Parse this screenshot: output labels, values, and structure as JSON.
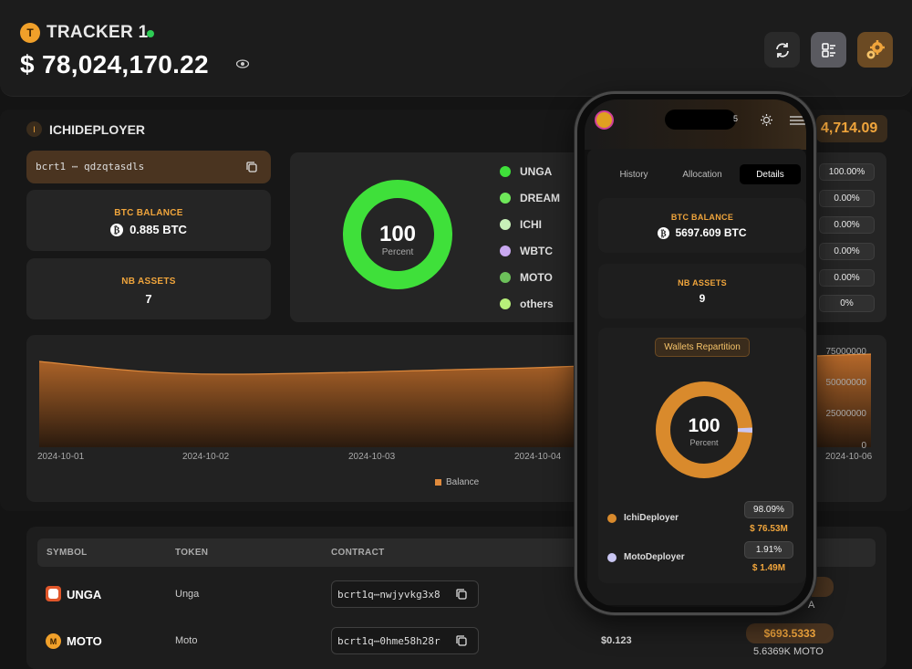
{
  "header": {
    "avatar_letter": "T",
    "tracker_name": "TRACKER 1",
    "total_value": "$ 78,024,170.22",
    "buttons": [
      "refresh-icon",
      "list-view-icon",
      "settings-icon"
    ]
  },
  "wallet": {
    "avatar_letter": "I",
    "name": "ICHIDEPLOYER",
    "total_partial": "4,714.09",
    "address": "bcrt1 ⋯ qdzqtasdls",
    "btc_balance_label": "BTC BALANCE",
    "btc_balance_value": "0.885 BTC",
    "nb_assets_label": "NB ASSETS",
    "nb_assets_value": "7"
  },
  "allocation": {
    "center_value": "100",
    "center_label": "Percent",
    "legend": [
      {
        "name": "UNGA",
        "color": "#3fe03a"
      },
      {
        "name": "DREAM",
        "color": "#6fe85a"
      },
      {
        "name": "ICHI",
        "color": "#c8f0b8"
      },
      {
        "name": "WBTC",
        "color": "#c9a8f0"
      },
      {
        "name": "MOTO",
        "color": "#6cc05a"
      },
      {
        "name": "others",
        "color": "#b8f07a"
      }
    ],
    "percentages": [
      "100.00%",
      "0.00%",
      "0.00%",
      "0.00%",
      "0.00%",
      "0%"
    ]
  },
  "balance_chart": {
    "x_ticks": [
      "2024-10-01",
      "2024-10-02",
      "2024-10-03",
      "2024-10-04",
      "2024-10-06"
    ],
    "y_ticks": [
      "75000000",
      "50000000",
      "25000000",
      "0"
    ],
    "legend": "Balance"
  },
  "assets_table": {
    "headers": {
      "symbol": "SYMBOL",
      "token": "TOKEN",
      "contract": "CONTRACT"
    },
    "rows": [
      {
        "symbol": "UNGA",
        "token": "Unga",
        "contract": "bcrt1q⋯nwjyvkg3x8",
        "price": "",
        "value": "",
        "amount": "A"
      },
      {
        "symbol": "MOTO",
        "token": "Moto",
        "contract": "bcrt1q⋯0hme58h28r",
        "price": "$0.123",
        "value": "$693.5333",
        "amount": "5.6369K MOTO"
      }
    ]
  },
  "phone": {
    "counter": "5",
    "tabs": [
      "History",
      "Allocation",
      "Details"
    ],
    "active_tab": "Details",
    "btc_balance_label": "BTC BALANCE",
    "btc_balance_value": "5697.609 BTC",
    "nb_assets_label": "NB ASSETS",
    "nb_assets_value": "9",
    "repartition_title": "Wallets Repartition",
    "center_value": "100",
    "center_label": "Percent",
    "wallets": [
      {
        "name": "IchiDeployer",
        "share": "98.09%",
        "value": "$ 76.53M",
        "color": "#d98a2c"
      },
      {
        "name": "MotoDeployer",
        "share": "1.91%",
        "value": "$ 1.49M",
        "color": "#c9c6f2"
      }
    ]
  },
  "colors": {
    "accent": "#f0a53c",
    "green": "#3fe03a",
    "orange": "#d98a2c"
  }
}
